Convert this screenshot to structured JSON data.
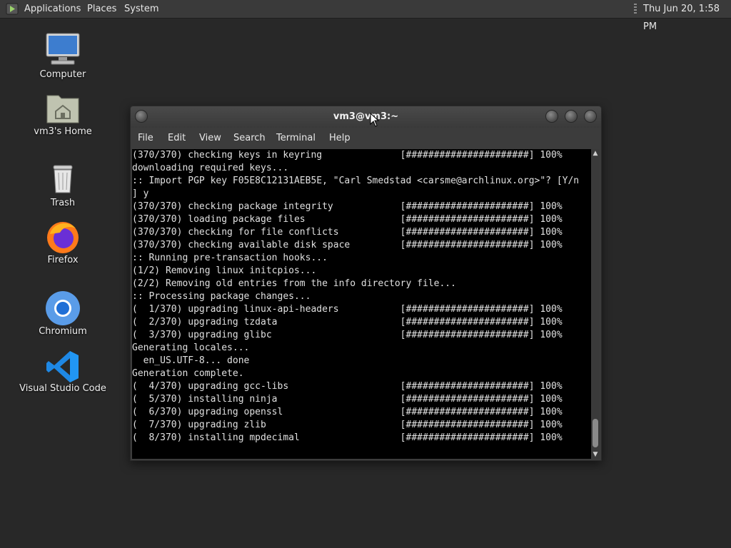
{
  "top_panel": {
    "menus": [
      "Applications",
      "Places",
      "System"
    ],
    "clock": "Thu Jun 20,  1:58 PM"
  },
  "desktop": {
    "icons": [
      {
        "label": "Computer",
        "icon": "computer-icon"
      },
      {
        "label": "vm3's Home",
        "icon": "home-folder-icon"
      },
      {
        "label": "Trash",
        "icon": "trash-icon"
      },
      {
        "label": "Firefox",
        "icon": "firefox-icon"
      },
      {
        "label": "Chromium",
        "icon": "chromium-icon"
      },
      {
        "label": "Visual Studio Code",
        "icon": "vscode-icon"
      }
    ]
  },
  "terminal": {
    "title": "vm3@vm3:~",
    "menu": [
      "File",
      "Edit",
      "View",
      "Search",
      "Terminal",
      "Help"
    ],
    "lines": [
      "(370/370) checking keys in keyring              [######################] 100%",
      "downloading required keys...",
      ":: Import PGP key F05E8C12131AEB5E, \"Carl Smedstad <carsme@archlinux.org>\"? [Y/n",
      "] y",
      "(370/370) checking package integrity            [######################] 100%",
      "(370/370) loading package files                 [######################] 100%",
      "(370/370) checking for file conflicts           [######################] 100%",
      "(370/370) checking available disk space         [######################] 100%",
      ":: Running pre-transaction hooks...",
      "(1/2) Removing linux initcpios...",
      "(2/2) Removing old entries from the info directory file...",
      ":: Processing package changes...",
      "(  1/370) upgrading linux-api-headers           [######################] 100%",
      "(  2/370) upgrading tzdata                      [######################] 100%",
      "(  3/370) upgrading glibc                       [######################] 100%",
      "Generating locales...",
      "  en_US.UTF-8... done",
      "Generation complete.",
      "(  4/370) upgrading gcc-libs                    [######################] 100%",
      "(  5/370) installing ninja                      [######################] 100%",
      "(  6/370) upgrading openssl                     [######################] 100%",
      "(  7/370) upgrading zlib                        [######################] 100%",
      "(  8/370) installing mpdecimal                  [######################] 100%"
    ]
  }
}
